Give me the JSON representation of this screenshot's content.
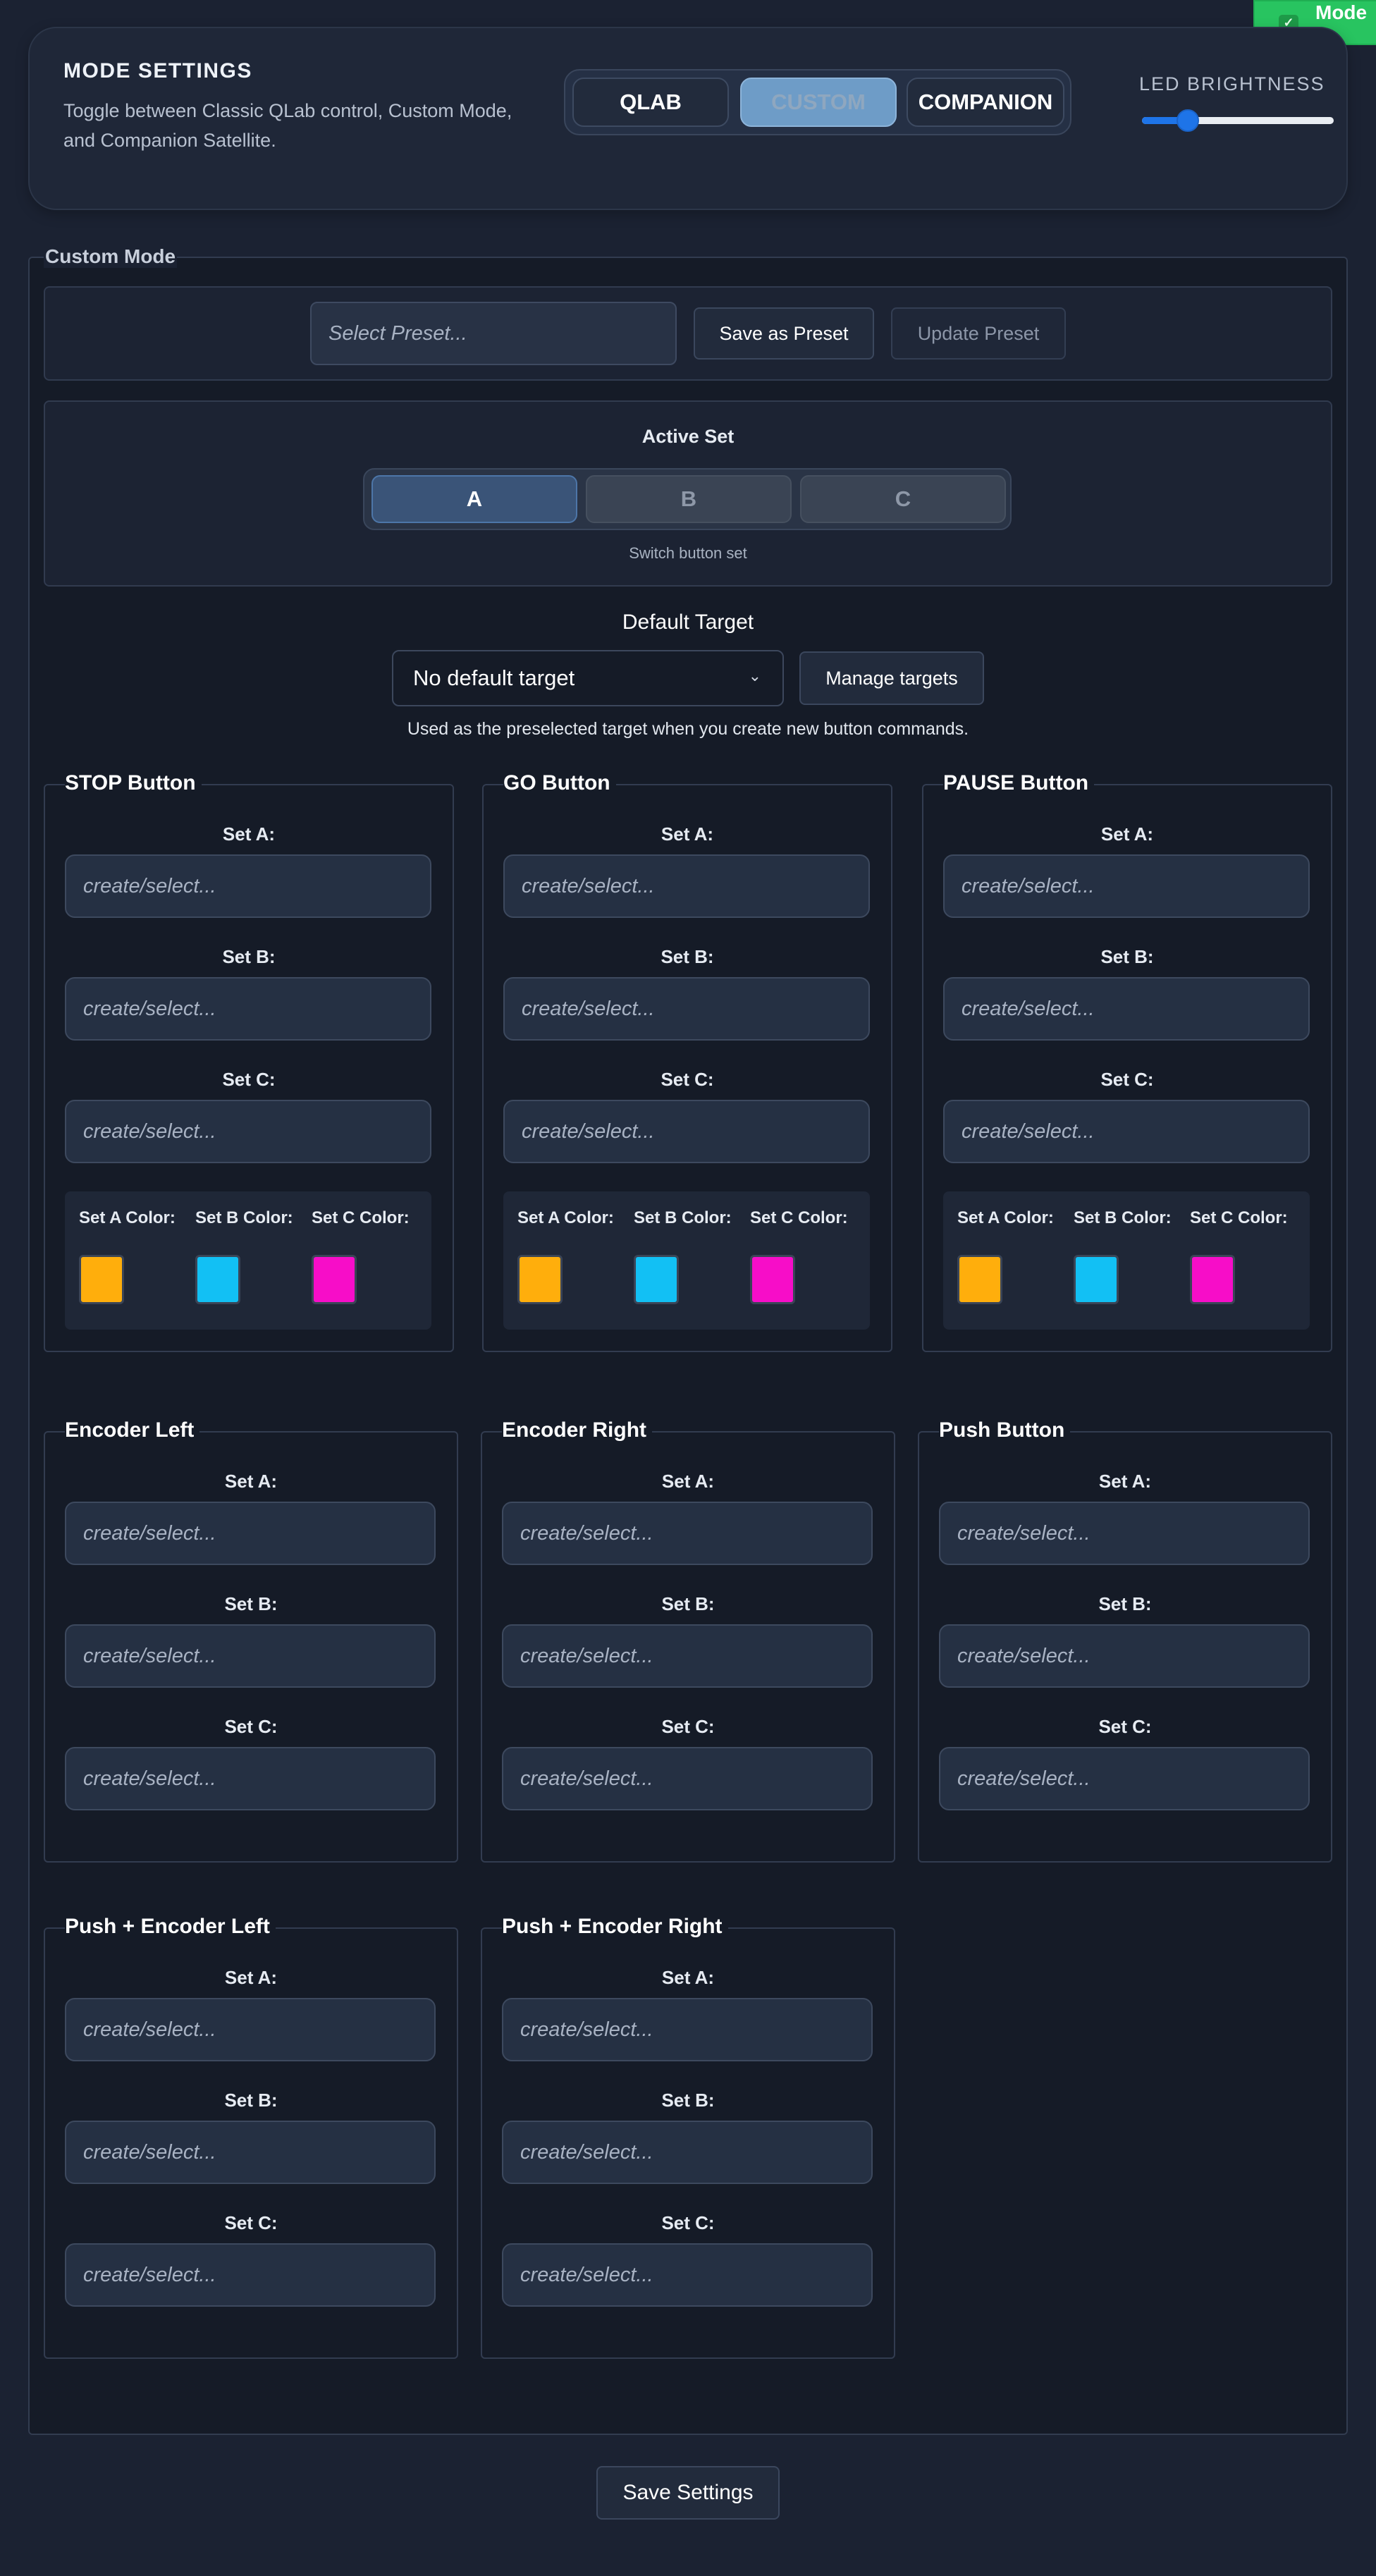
{
  "toast": {
    "text": "Mode"
  },
  "mode_settings": {
    "title": "MODE SETTINGS",
    "description": "Toggle between Classic QLab control, Custom Mode, and Companion Satellite.",
    "modes": [
      {
        "label": "QLAB",
        "active": false
      },
      {
        "label": "CUSTOM",
        "active": true
      },
      {
        "label": "COMPANION",
        "active": false
      }
    ],
    "led_label": "LED BRIGHTNESS",
    "led_value_fraction": 0.24
  },
  "custom": {
    "legend": "Custom Mode",
    "preset_placeholder": "Select Preset...",
    "save_preset": "Save as Preset",
    "update_preset": "Update Preset",
    "active_set_label": "Active Set",
    "sets": [
      {
        "label": "A",
        "active": true
      },
      {
        "label": "B",
        "active": false
      },
      {
        "label": "C",
        "active": false
      }
    ],
    "switch_hint": "Switch button set",
    "default_target_label": "Default Target",
    "default_target_value": "No default target",
    "manage_targets": "Manage targets",
    "target_hint": "Used as the preselected target when you create new button commands.",
    "set_labels": {
      "a": "Set A:",
      "b": "Set B:",
      "c": "Set C:"
    },
    "input_placeholder": "create/select...",
    "color_labels": {
      "a": "Set A Color:",
      "b": "Set B Color:",
      "c": "Set C Color:"
    },
    "colors": {
      "a": "#ffae0c",
      "b": "#12c0f4",
      "c": "#f70dc8"
    },
    "groups": [
      {
        "title": "STOP Button",
        "has_colors": true
      },
      {
        "title": "GO Button",
        "has_colors": true
      },
      {
        "title": "PAUSE Button",
        "has_colors": true
      },
      {
        "title": "Encoder Left",
        "has_colors": false
      },
      {
        "title": "Encoder Right",
        "has_colors": false
      },
      {
        "title": "Push Button",
        "has_colors": false
      },
      {
        "title": "Push + Encoder Left",
        "has_colors": false
      },
      {
        "title": "Push + Encoder Right",
        "has_colors": false
      }
    ],
    "save_settings": "Save Settings"
  }
}
